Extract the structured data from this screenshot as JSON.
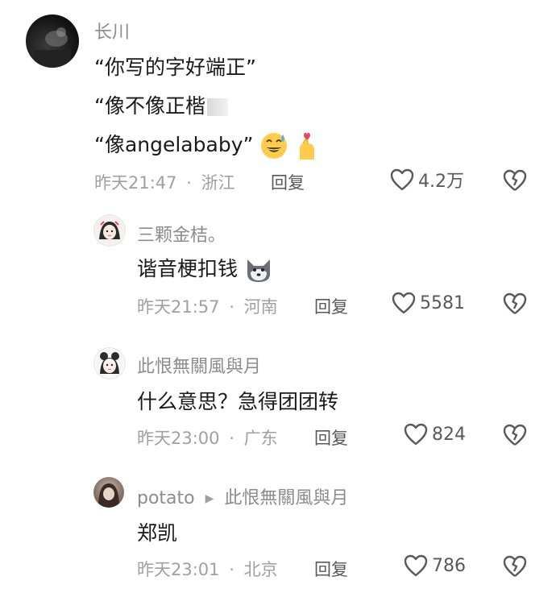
{
  "comments": [
    {
      "username": "长川",
      "lines": [
        "“你写的字好端正”",
        "“像不像正楷",
        "“像angelababy”"
      ],
      "time": "昨天21:47",
      "location": "浙江",
      "reply_label": "回复",
      "likes": "4.2万"
    },
    {
      "username": "三颗金桔。",
      "lines": [
        "谐音梗扣钱"
      ],
      "time": "昨天21:57",
      "location": "河南",
      "reply_label": "回复",
      "likes": "5581"
    },
    {
      "username": "此恨無關風與月",
      "lines": [
        "什么意思？急得团团转"
      ],
      "time": "昨天23:00",
      "location": "广东",
      "reply_label": "回复",
      "likes": "824"
    },
    {
      "username": "potato",
      "reply_to": "此恨無關風與月",
      "lines": [
        "郑凯"
      ],
      "time": "昨天23:01",
      "location": "北京",
      "reply_label": "回复",
      "likes": "786"
    }
  ],
  "separator": "·",
  "icons": {
    "like": "heart-outline-icon",
    "dislike": "broken-heart-icon",
    "emoji_1": "grinning-sweat-emoji",
    "emoji_2": "finger-heart-emoji",
    "emoji_3": "shiba-dog-emoji"
  }
}
